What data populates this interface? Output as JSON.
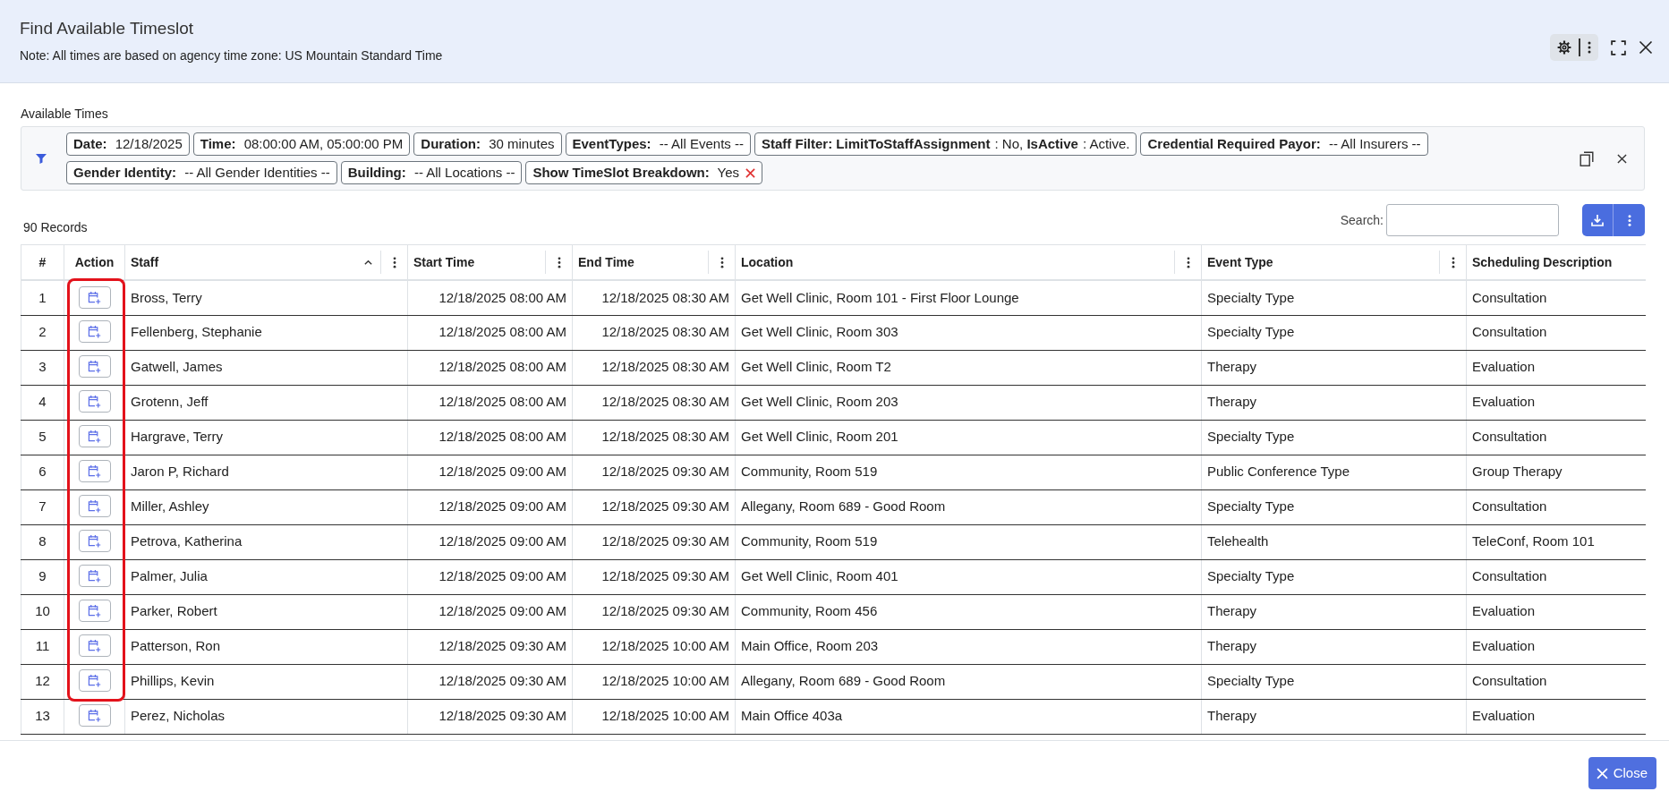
{
  "dialog": {
    "title": "Find Available Timeslot",
    "note": "Note: All times are based on agency time zone: US Mountain Standard Time"
  },
  "filters": {
    "label": "Available Times",
    "chips": [
      {
        "text": "**Date:** 12/18/2025",
        "removable": false
      },
      {
        "text": "**Time:** 08:00:00 AM, 05:00:00 PM",
        "removable": false
      },
      {
        "text": "**Duration:** 30 minutes",
        "removable": false
      },
      {
        "text": "**EventTypes:** -- All Events --",
        "removable": false
      },
      {
        "text": "**Staff Filter: LimitToStaffAssignment**: No, **IsActive**: Active.",
        "removable": false
      },
      {
        "text": "**Credential Required Payor:** -- All Insurers --",
        "removable": false
      },
      {
        "text": "**Gender Identity:** -- All Gender Identities --",
        "removable": false
      },
      {
        "text": "**Building:** -- All Locations --",
        "removable": false
      },
      {
        "text": "**Show TimeSlot Breakdown:** Yes",
        "removable": true
      }
    ]
  },
  "records": {
    "count": "90 Records"
  },
  "search": {
    "label": "Search:"
  },
  "table": {
    "columns": [
      {
        "label": "#",
        "kind": "index",
        "sorted": false,
        "menu": false
      },
      {
        "label": "Action",
        "kind": "action",
        "sorted": false,
        "menu": false
      },
      {
        "label": "Staff",
        "kind": "text",
        "sorted": true,
        "menu": true
      },
      {
        "label": "Start Time",
        "kind": "time",
        "sorted": false,
        "menu": true
      },
      {
        "label": "End Time",
        "kind": "time",
        "sorted": false,
        "menu": true
      },
      {
        "label": "Location",
        "kind": "text",
        "sorted": false,
        "menu": true
      },
      {
        "label": "Event Type",
        "kind": "text",
        "sorted": false,
        "menu": true
      },
      {
        "label": "Scheduling Description",
        "kind": "text",
        "sorted": false,
        "menu": false
      }
    ],
    "rows": [
      {
        "highlighted": true,
        "cells": [
          "1",
          "",
          "Bross, Terry",
          "12/18/2025 08:00 AM",
          "12/18/2025 08:30 AM",
          "Get Well Clinic, Room 101 - First Floor Lounge",
          "Specialty Type",
          "Consultation"
        ]
      },
      {
        "highlighted": true,
        "cells": [
          "2",
          "",
          "Fellenberg, Stephanie",
          "12/18/2025 08:00 AM",
          "12/18/2025 08:30 AM",
          "Get Well Clinic, Room 303",
          "Specialty Type",
          "Consultation"
        ]
      },
      {
        "highlighted": true,
        "cells": [
          "3",
          "",
          "Gatwell, James",
          "12/18/2025 08:00 AM",
          "12/18/2025 08:30 AM",
          "Get Well Clinic, Room T2",
          "Therapy",
          "Evaluation"
        ]
      },
      {
        "highlighted": true,
        "cells": [
          "4",
          "",
          "Grotenn, Jeff",
          "12/18/2025 08:00 AM",
          "12/18/2025 08:30 AM",
          "Get Well Clinic, Room 203",
          "Therapy",
          "Evaluation"
        ]
      },
      {
        "highlighted": true,
        "cells": [
          "5",
          "",
          "Hargrave, Terry",
          "12/18/2025 08:00 AM",
          "12/18/2025 08:30 AM",
          "Get Well Clinic, Room 201",
          "Specialty Type",
          "Consultation"
        ]
      },
      {
        "highlighted": true,
        "cells": [
          "6",
          "",
          "Jaron P, Richard",
          "12/18/2025 09:00 AM",
          "12/18/2025 09:30 AM",
          "Community, Room 519",
          "Public Conference Type",
          "Group Therapy"
        ]
      },
      {
        "highlighted": true,
        "cells": [
          "7",
          "",
          "Miller, Ashley",
          "12/18/2025 09:00 AM",
          "12/18/2025 09:30 AM",
          "Allegany, Room 689 - Good Room",
          "Specialty Type",
          "Consultation"
        ]
      },
      {
        "highlighted": true,
        "cells": [
          "8",
          "",
          "Petrova, Katherina",
          "12/18/2025 09:00 AM",
          "12/18/2025 09:30 AM",
          "Community, Room 519",
          "Telehealth",
          "TeleConf, Room 101"
        ]
      },
      {
        "highlighted": true,
        "cells": [
          "9",
          "",
          "Palmer, Julia",
          "12/18/2025 09:00 AM",
          "12/18/2025 09:30 AM",
          "Get Well Clinic, Room 401",
          "Specialty Type",
          "Consultation"
        ]
      },
      {
        "highlighted": true,
        "cells": [
          "10",
          "",
          "Parker, Robert",
          "12/18/2025 09:00 AM",
          "12/18/2025 09:30 AM",
          "Community, Room 456",
          "Therapy",
          "Evaluation"
        ]
      },
      {
        "highlighted": true,
        "cells": [
          "11",
          "",
          "Patterson, Ron",
          "12/18/2025 09:30 AM",
          "12/18/2025 10:00 AM",
          "Main Office, Room 203",
          "Therapy",
          "Evaluation"
        ]
      },
      {
        "highlighted": true,
        "cells": [
          "12",
          "",
          "Phillips, Kevin",
          "12/18/2025 09:30 AM",
          "12/18/2025 10:00 AM",
          "Allegany, Room 689 - Good Room",
          "Specialty Type",
          "Consultation"
        ]
      },
      {
        "highlighted": false,
        "cells": [
          "13",
          "",
          "Perez, Nicholas",
          "12/18/2025 09:30 AM",
          "12/18/2025 10:00 AM",
          "Main Office 403a",
          "Therapy",
          "Evaluation"
        ]
      }
    ]
  },
  "footer": {
    "close_button": "Close"
  }
}
